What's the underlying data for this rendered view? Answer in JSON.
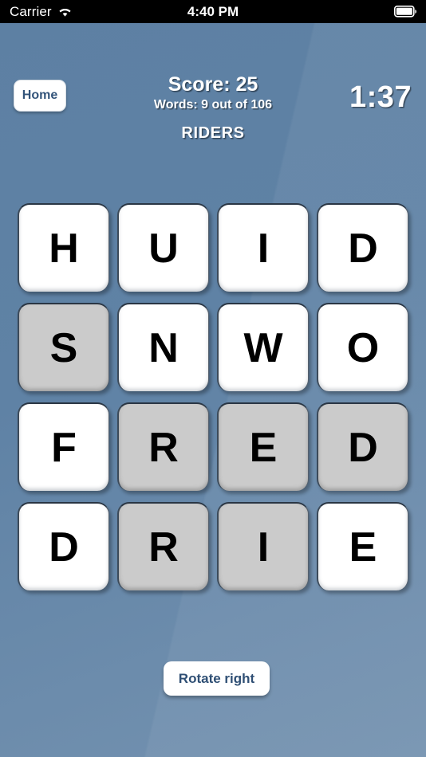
{
  "status_bar": {
    "carrier": "Carrier",
    "wifi_icon": "wifi-icon",
    "time": "4:40 PM",
    "battery_icon": "battery-full-icon"
  },
  "header": {
    "home_label": "Home",
    "score_text": "Score: 25",
    "words_text": "Words: 9 out of 106",
    "found_word": "RIDERS",
    "timer": "1:37"
  },
  "board": {
    "rows": 4,
    "cols": 4,
    "tiles": [
      {
        "letter": "H",
        "selected": false
      },
      {
        "letter": "U",
        "selected": false
      },
      {
        "letter": "I",
        "selected": false
      },
      {
        "letter": "D",
        "selected": false
      },
      {
        "letter": "S",
        "selected": true
      },
      {
        "letter": "N",
        "selected": false
      },
      {
        "letter": "W",
        "selected": false
      },
      {
        "letter": "O",
        "selected": false
      },
      {
        "letter": "F",
        "selected": false
      },
      {
        "letter": "R",
        "selected": true
      },
      {
        "letter": "E",
        "selected": true
      },
      {
        "letter": "D",
        "selected": true
      },
      {
        "letter": "D",
        "selected": false
      },
      {
        "letter": "R",
        "selected": true
      },
      {
        "letter": "I",
        "selected": true
      },
      {
        "letter": "E",
        "selected": false
      }
    ]
  },
  "controls": {
    "rotate_label": "Rotate right"
  },
  "colors": {
    "background": "#5d80a3",
    "tile_unselected": "#ffffff",
    "tile_selected": "#cbcbcb",
    "button_text": "#2f4f74",
    "text_on_background": "#ffffff"
  }
}
